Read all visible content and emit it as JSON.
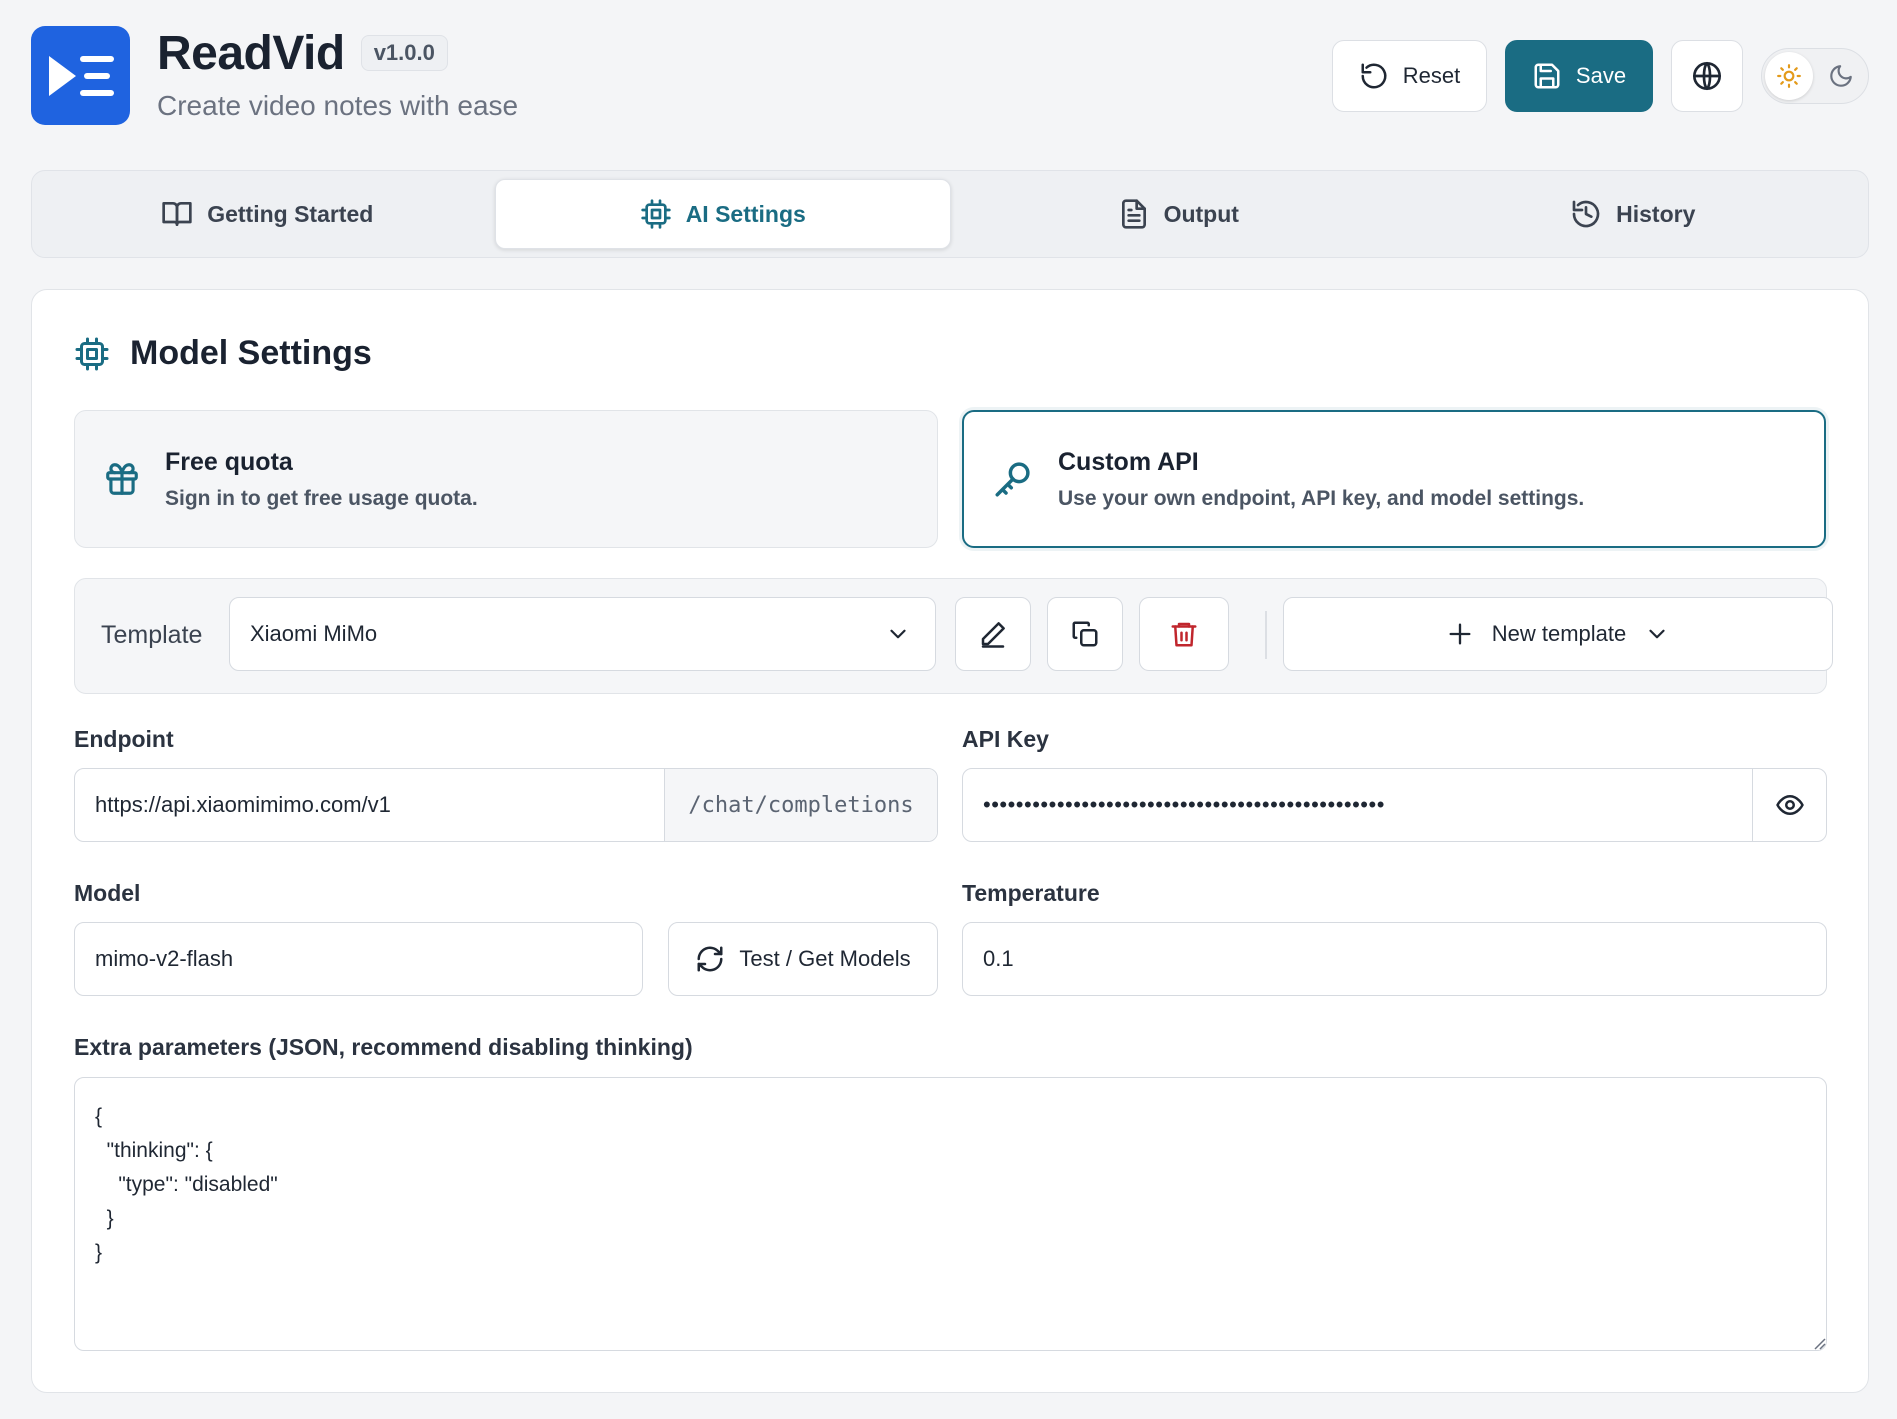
{
  "app": {
    "title": "ReadVid",
    "version": "v1.0.0",
    "subtitle": "Create video notes with ease"
  },
  "header": {
    "reset_label": "Reset",
    "save_label": "Save",
    "theme": "light"
  },
  "tabs": [
    {
      "label": "Getting Started",
      "icon": "book-icon"
    },
    {
      "label": "AI Settings",
      "icon": "chip-icon",
      "active": true
    },
    {
      "label": "Output",
      "icon": "document-icon"
    },
    {
      "label": "History",
      "icon": "history-icon"
    }
  ],
  "section": {
    "title": "Model Settings"
  },
  "modes": {
    "free": {
      "title": "Free quota",
      "description": "Sign in to get free usage quota."
    },
    "custom": {
      "title": "Custom API",
      "description": "Use your own endpoint, API key, and model settings.",
      "selected": true
    }
  },
  "template": {
    "label": "Template",
    "selected": "Xiaomi MiMo",
    "new_label": "New template"
  },
  "fields": {
    "endpoint": {
      "label": "Endpoint",
      "value": "https://api.xiaomimimo.com/v1",
      "suffix": "/chat/completions"
    },
    "api_key": {
      "label": "API Key",
      "masked_value": "•••••••••••••••••••••••••••••••••••••••••••••••••"
    },
    "model": {
      "label": "Model",
      "value": "mimo-v2-flash",
      "test_label": "Test / Get Models"
    },
    "temperature": {
      "label": "Temperature",
      "value": "0.1"
    },
    "extra": {
      "label": "Extra parameters (JSON, recommend disabling thinking)",
      "value": "{\n  \"thinking\": {\n    \"type\": \"disabled\"\n  }\n}"
    }
  },
  "colors": {
    "accent": "#1a6c83",
    "logo": "#1f63e0",
    "danger": "#c0262d"
  }
}
